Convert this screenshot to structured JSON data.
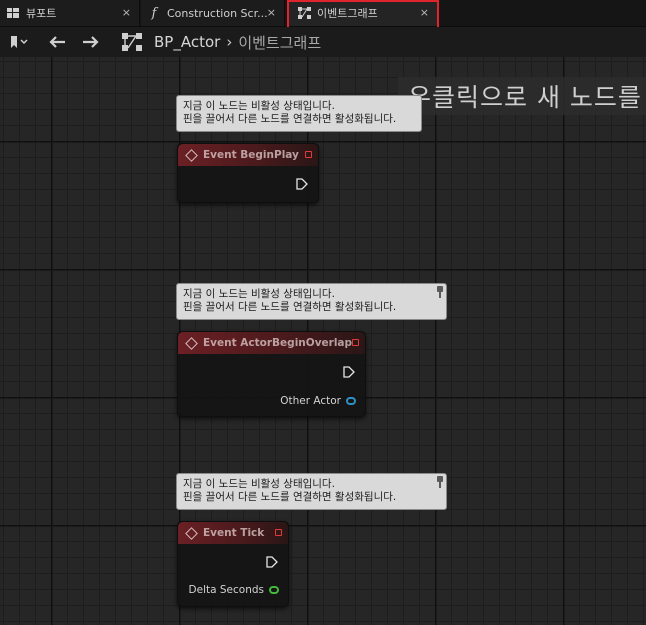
{
  "tabs": [
    {
      "label": "뷰포트",
      "icon": "viewport-icon",
      "close": "×"
    },
    {
      "label": "Construction Scr...",
      "icon": "function-icon",
      "close": "×"
    },
    {
      "label": "이벤트그래프",
      "icon": "event-graph-icon",
      "close": "×",
      "active": true
    }
  ],
  "breadcrumb": {
    "blueprint": "BP_Actor",
    "separator": "›",
    "current": "이벤트그래프"
  },
  "hint": "우클릭으로 새 노드를",
  "comments": {
    "line1": "지금 이 노드는 비활성 상태입니다.",
    "line2": "핀을 끌어서 다른 노드를 연결하면 활성화됩니다."
  },
  "nodes": [
    {
      "title": "Event BeginPlay"
    },
    {
      "title": "Event ActorBeginOverlap",
      "pin_label": "Other Actor",
      "pin_color": "#2f8fc7"
    },
    {
      "title": "Event Tick",
      "pin_label": "Delta Seconds",
      "pin_color": "#44b83a"
    }
  ],
  "colors": {
    "tab_highlight": "#e0242b",
    "event_header": "#6b2024"
  }
}
